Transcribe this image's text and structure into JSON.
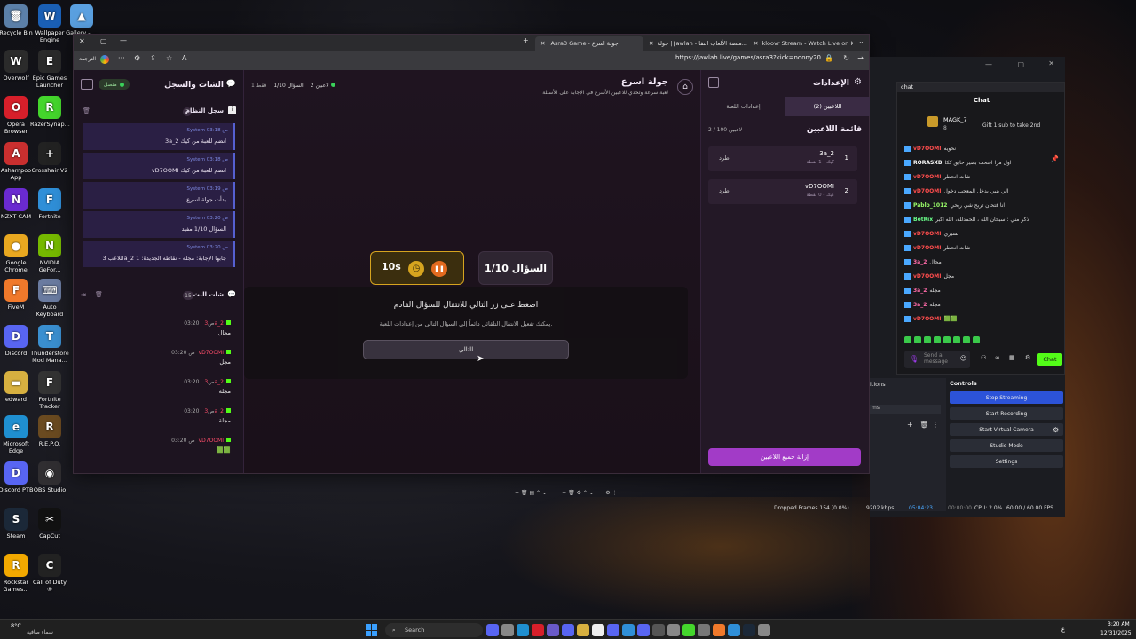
{
  "desktop": {
    "icons": [
      {
        "label": "Recycle Bin",
        "color": "#5b7fa8",
        "glyph": "🗑"
      },
      {
        "label": "Overwolf",
        "color": "#2b2b2b",
        "glyph": "W"
      },
      {
        "label": "Opera Browser",
        "color": "#d71f2a",
        "glyph": "O"
      },
      {
        "label": "Ashampoo App",
        "color": "#c92f2f",
        "glyph": "A"
      },
      {
        "label": "NZXT CAM",
        "color": "#6a2ad0",
        "glyph": "N"
      },
      {
        "label": "Google Chrome",
        "color": "#e9a820",
        "glyph": "●"
      },
      {
        "label": "FiveM",
        "color": "#f0792b",
        "glyph": "F"
      },
      {
        "label": "Discord",
        "color": "#5865f2",
        "glyph": "D"
      },
      {
        "label": "edward",
        "color": "#d7b040",
        "glyph": "▬"
      },
      {
        "label": "Microsoft Edge",
        "color": "#1f8fd0",
        "glyph": "e"
      },
      {
        "label": "Discord PTB",
        "color": "#5865f2",
        "glyph": "D"
      },
      {
        "label": "Steam",
        "color": "#1b2838",
        "glyph": "S"
      },
      {
        "label": "Rockstar Games...",
        "color": "#f2a900",
        "glyph": "R"
      },
      {
        "label": "Wallpaper Engine",
        "color": "#1a5fb4",
        "glyph": "W"
      },
      {
        "label": "Epic Games Launcher",
        "color": "#2a2a2a",
        "glyph": "E"
      },
      {
        "label": "RazerSynap...",
        "color": "#44d62c",
        "glyph": "R"
      },
      {
        "label": "Crosshair V2",
        "color": "#222",
        "glyph": "+"
      },
      {
        "label": "Fortnite",
        "color": "#2f8fd8",
        "glyph": "F"
      },
      {
        "label": "NVIDIA GeFor...",
        "color": "#76b900",
        "glyph": "N"
      },
      {
        "label": "Auto Keyboard",
        "color": "#6a7ba0",
        "glyph": "⌨"
      },
      {
        "label": "Thunderstore Mod Mana...",
        "color": "#3a8fd0",
        "glyph": "T"
      },
      {
        "label": "Fortnite Tracker",
        "color": "#333",
        "glyph": "F"
      },
      {
        "label": "R.E.P.O.",
        "color": "#6a4a20",
        "glyph": "R"
      },
      {
        "label": "OBS Studio",
        "color": "#302e31",
        "glyph": "◉"
      },
      {
        "label": "CapCut",
        "color": "#111",
        "glyph": "✂"
      },
      {
        "label": "Call of Duty ®",
        "color": "#222",
        "glyph": "C"
      },
      {
        "label": "Gallery - ...",
        "color": "#5aa0e0",
        "glyph": "▲"
      }
    ]
  },
  "browser": {
    "tabs": [
      "kloovr Stream - Watch Live on Kick",
      "جولة | Jawlah - منصة الألعاب التفا...",
      "Asra3 Game - جولة اسرع"
    ],
    "url": "https://jawlah.live/games/asra3?kick=noony20",
    "translate_label": "الترجمة"
  },
  "game": {
    "left": {
      "title": "الشات والسجل",
      "status": "متصل",
      "system_log_title": "سجل النظام",
      "system_log_count": "7",
      "system_items": [
        {
          "meta": "System 03:18 ص",
          "text": "3a_2 انضم للعبة من كيك"
        },
        {
          "meta": "System 03:18 ص",
          "text": "vD7OOMI انضم للعبة من كيك"
        },
        {
          "meta": "System 03:19 ص",
          "text": "بدأت جولة اسرع"
        },
        {
          "meta": "System 03:20 ص",
          "text": "السؤال 1/10 مفيد"
        },
        {
          "meta": "System 03:20 ص",
          "text": "اللاعب 3a_2 جابها الإجابة: مجله - نقاطه الجديدة: 1"
        }
      ],
      "chat_title": "شات البث",
      "chat_count": "15",
      "chat_messages": [
        {
          "user": "3a_2",
          "time": "03:20 ص",
          "text": "مجال"
        },
        {
          "user": "vD7OOMI",
          "time": "03:20 ص",
          "text": "مجل"
        },
        {
          "user": "3a_2",
          "time": "03:20 ص",
          "text": "مجله"
        },
        {
          "user": "3a_2",
          "time": "03:20 ص",
          "text": "مجلة"
        },
        {
          "user": "vD7OOMI",
          "time": "03:20 ص",
          "text": "🟩🟩"
        }
      ]
    },
    "center": {
      "title": "جولة اسرع",
      "subtitle": "لعبة سرعة وتحدي للاعبين الأسرع في الإجابة على الأسئلة",
      "players_count": "2 لاعبين",
      "question_progress": "السؤال 1/10",
      "points": "1 فقط",
      "question_card": "السؤال 1/10",
      "timer": "10s",
      "prompt": "اضغط على زر التالي للانتقال للسؤال القادم",
      "hint": "يمكنك تفعيل الانتقال التلقائي دائماً إلى السؤال التالي من إعدادات اللعبة.",
      "next_button": "التالي"
    },
    "right": {
      "title": "الإعدادات",
      "tabs": [
        "اللاعبين (2)",
        "إعدادات اللعبة"
      ],
      "players_title": "قائمة اللاعبين",
      "players_count": "2 / 100 لاعبين",
      "players": [
        {
          "rank": "1",
          "name": "3a_2",
          "sub": "كيك - 1 نقطة",
          "kick": "طرد"
        },
        {
          "rank": "2",
          "name": "vD7OOMI",
          "sub": "كيك - 0 نقطة",
          "kick": "طرد"
        }
      ],
      "remove_all": "إزالة جميع اللاعبين"
    }
  },
  "obs": {
    "chat_header": "chat",
    "chat_title": "Chat",
    "top_user": "MAGK_7",
    "top_user_count": "8",
    "gift_text": "Gift 1 sub to take 2nd",
    "lines": [
      {
        "user": "vD7OOMI",
        "text": "نحويه",
        "color": "#ff4d4d"
      },
      {
        "user": "RORASXB",
        "text": "اول مرا افتحت بصير حابق ككا",
        "color": "#ffffff"
      },
      {
        "user": "vD7OOMI",
        "text": "شات انحظر",
        "color": "#ff4d4d"
      },
      {
        "user": "vD7OOMI",
        "text": "الي ينبي يدخل المعجب دخول",
        "color": "#ff4d4d"
      },
      {
        "user": "Pablo_1012",
        "text": "انا فتحان تربح شي ربحي",
        "color": "#9bff6a"
      },
      {
        "user": "BotRix",
        "text": "ذكر مني : سبحان الله ، الحمدلله، الله اكبر",
        "color": "#6aff8a"
      },
      {
        "user": "vD7OOMI",
        "text": "نسيري",
        "color": "#ff4d4d"
      },
      {
        "user": "vD7OOMI",
        "text": "شات انحظر",
        "color": "#ff4d4d"
      },
      {
        "user": "3a_2",
        "text": "مجال",
        "color": "#ff6aa8"
      },
      {
        "user": "vD7OOMI",
        "text": "مجل",
        "color": "#ff4d4d"
      },
      {
        "user": "3a_2",
        "text": "مجله",
        "color": "#ff6aa8"
      },
      {
        "user": "3a_2",
        "text": "مجلة",
        "color": "#ff6aa8"
      },
      {
        "user": "vD7OOMI",
        "text": "🟩🟩",
        "color": "#ff4d4d"
      }
    ],
    "send_placeholder": "Send a message",
    "chat_button": "Chat",
    "controls_title": "Controls",
    "transitions_title": "itions",
    "duration": "ms",
    "controls": [
      "Stop Streaming",
      "Start Recording",
      "Start Virtual Camera",
      "Studio Mode",
      "Settings"
    ],
    "status": {
      "dropped": "Dropped Frames 154 (0.0%)",
      "kbps": "9202 kbps",
      "live_time": "05:04:23",
      "rec_time": "00:00:00",
      "cpu": "CPU: 2.0%",
      "fps": "60.00 / 60.00 FPS"
    }
  },
  "taskbar": {
    "weather_temp": "8°C",
    "weather_desc": "سماء صافية",
    "search_placeholder": "Search",
    "lang": "ع",
    "time": "3:20 AM",
    "date": "12/31/2025"
  }
}
